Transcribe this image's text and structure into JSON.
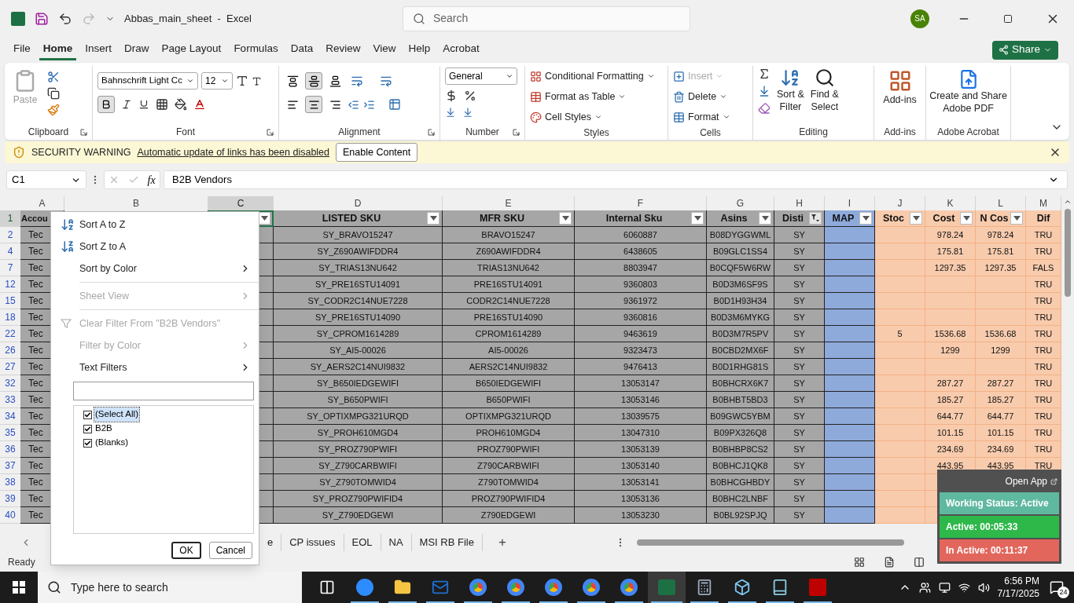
{
  "title_bar": {
    "title": "Abbas_main_sheet  -  Excel",
    "search_placeholder": "Search",
    "avatar": "SA"
  },
  "menu_tabs": [
    {
      "label": "File",
      "selected": false
    },
    {
      "label": "Home",
      "selected": true
    },
    {
      "label": "Insert",
      "selected": false
    },
    {
      "label": "Draw",
      "selected": false
    },
    {
      "label": "Page Layout",
      "selected": false
    },
    {
      "label": "Formulas",
      "selected": false
    },
    {
      "label": "Data",
      "selected": false
    },
    {
      "label": "Review",
      "selected": false
    },
    {
      "label": "View",
      "selected": false
    },
    {
      "label": "Help",
      "selected": false
    },
    {
      "label": "Acrobat",
      "selected": false
    }
  ],
  "share": "Share",
  "ribbon": {
    "clipboard": {
      "paste": "Paste",
      "label": "Clipboard"
    },
    "font": {
      "name": "Bahnschrift Light Cc",
      "size": "12",
      "bold": true,
      "label": "Font"
    },
    "alignment": {
      "vertical": [
        {
          "kind": "top",
          "selected": false
        },
        {
          "kind": "middle",
          "selected": true
        },
        {
          "kind": "bottom",
          "selected": false
        }
      ],
      "horizontal": [
        {
          "kind": "left",
          "selected": false
        },
        {
          "kind": "center",
          "selected": true
        },
        {
          "kind": "right",
          "selected": false
        }
      ],
      "label": "Alignment"
    },
    "number": {
      "format": "General",
      "label": "Number"
    },
    "styles": {
      "items": [
        "Conditional Formatting",
        "Format as Table",
        "Cell Styles"
      ],
      "label": "Styles"
    },
    "cells": {
      "items": [
        {
          "label": "Insert",
          "disabled": true
        },
        {
          "label": "Delete",
          "disabled": false
        },
        {
          "label": "Format",
          "disabled": false
        }
      ],
      "label": "Cells"
    },
    "editing": {
      "sort": [
        "Sort &",
        "Filter"
      ],
      "find": [
        "Find &",
        "Select"
      ],
      "label": "Editing"
    },
    "addins": {
      "button": "Add-ins",
      "label": "Add-ins"
    },
    "acrobat": {
      "button": [
        "Create and Share",
        "Adobe PDF"
      ],
      "label": "Adobe Acrobat"
    }
  },
  "security_warning": {
    "title": "SECURITY WARNING",
    "message": "Automatic update of links has been disabled",
    "button": "Enable Content"
  },
  "formula_bar": {
    "name_box": "C1",
    "fx": "fx",
    "value": "B2B Vendors"
  },
  "sheet": {
    "columns": [
      {
        "letter": "A",
        "header": "Accou",
        "color": "#a6a6a6",
        "selected": false
      },
      {
        "letter": "B",
        "selected": false
      },
      {
        "letter": "C",
        "color": "#a6a6a6",
        "filter_button": true,
        "filtered": false,
        "selected": true
      },
      {
        "letter": "D",
        "header": "LISTED SKU",
        "color": "#a6a6a6",
        "filter_button": true,
        "filtered": false,
        "selected": false
      },
      {
        "letter": "E",
        "header": "MFR SKU",
        "color": "#a6a6a6",
        "filter_button": true,
        "filtered": false,
        "selected": false
      },
      {
        "letter": "F",
        "header": "Internal Sku",
        "color": "#a6a6a6",
        "filter_button": true,
        "filtered": false,
        "selected": false
      },
      {
        "letter": "G",
        "header": "Asins",
        "color": "#a6a6a6",
        "filter_button": true,
        "filtered": false,
        "selected": false
      },
      {
        "letter": "H",
        "header": "Disti",
        "color": "#a6a6a6",
        "filter_button": true,
        "filtered": true,
        "selected": false
      },
      {
        "letter": "I",
        "header": "MAP",
        "color": "#8eaadb",
        "filter_button": true,
        "filtered": false,
        "selected": false
      },
      {
        "letter": "J",
        "header": "Stoc",
        "color": "#f8cbad",
        "filter_button": true,
        "filtered": false,
        "selected": false
      },
      {
        "letter": "K",
        "header": "Cost",
        "color": "#f8cbad",
        "filter_button": true,
        "filtered": false,
        "selected": false
      },
      {
        "letter": "L",
        "header": "N Cos",
        "color": "#f8cbad",
        "filter_button": true,
        "filtered": false,
        "selected": false
      },
      {
        "letter": "M",
        "header": "Dif",
        "color": "#f8cbad",
        "selected": false
      }
    ],
    "rows": [
      {
        "row": "1",
        "selected": true,
        "cells": null
      },
      {
        "row": "2",
        "selected": false,
        "cells": [
          "Tec",
          null,
          null,
          "SY_BRAVO15247",
          "BRAVO15247",
          "6060887",
          "B08DYGGWML",
          "SY",
          null,
          null,
          "978.24",
          "978.24",
          "TRU"
        ]
      },
      {
        "row": "4",
        "selected": false,
        "cells": [
          "Tec",
          null,
          null,
          "SY_Z690AWIFDDR4",
          "Z690AWIFDDR4",
          "6438605",
          "B09GLC1SS4",
          "SY",
          null,
          null,
          "175.81",
          "175.81",
          "TRU"
        ]
      },
      {
        "row": "7",
        "selected": false,
        "cells": [
          "Tec",
          null,
          null,
          "SY_TRIAS13NU642",
          "TRIAS13NU642",
          "8803947",
          "B0CQF5W6RW",
          "SY",
          null,
          null,
          "1297.35",
          "1297.35",
          "FALS"
        ]
      },
      {
        "row": "12",
        "selected": false,
        "cells": [
          "Tec",
          null,
          null,
          "SY_PRE16STU14091",
          "PRE16STU14091",
          "9360803",
          "B0D3M6SF9S",
          "SY",
          null,
          null,
          null,
          null,
          "TRU"
        ]
      },
      {
        "row": "15",
        "selected": false,
        "cells": [
          "Tec",
          null,
          null,
          "SY_CODR2C14NUE7228",
          "CODR2C14NUE7228",
          "9361972",
          "B0D1H93H34",
          "SY",
          null,
          null,
          null,
          null,
          "TRU"
        ]
      },
      {
        "row": "18",
        "selected": false,
        "cells": [
          "Tec",
          null,
          null,
          "SY_PRE16STU14090",
          "PRE16STU14090",
          "9360816",
          "B0D3M6MYKG",
          "SY",
          null,
          null,
          null,
          null,
          "TRU"
        ]
      },
      {
        "row": "22",
        "selected": false,
        "cells": [
          "Tec",
          null,
          null,
          "SY_CPROM1614289",
          "CPROM1614289",
          "9463619",
          "B0D3M7R5PV",
          "SY",
          null,
          "5",
          "1536.68",
          "1536.68",
          "TRU"
        ]
      },
      {
        "row": "26",
        "selected": false,
        "cells": [
          "Tec",
          null,
          null,
          "SY_AI5-00026",
          "AI5-00026",
          "9323473",
          "B0CBD2MX6F",
          "SY",
          null,
          null,
          "1299",
          "1299",
          "TRU"
        ]
      },
      {
        "row": "27",
        "selected": false,
        "cells": [
          "Tec",
          null,
          null,
          "SY_AERS2C14NUI9832",
          "AERS2C14NUI9832",
          "9476413",
          "B0D1RHG81S",
          "SY",
          null,
          null,
          null,
          null,
          "TRU"
        ]
      },
      {
        "row": "32",
        "selected": false,
        "cells": [
          "Tec",
          null,
          null,
          "SY_B650IEDGEWIFI",
          "B650IEDGEWIFI",
          "13053147",
          "B0BHCRX6K7",
          "SY",
          null,
          null,
          "287.27",
          "287.27",
          "TRU"
        ]
      },
      {
        "row": "33",
        "selected": false,
        "cells": [
          "Tec",
          null,
          null,
          "SY_B650PWIFI",
          "B650PWIFI",
          "13053146",
          "B0BHBT5BD3",
          "SY",
          null,
          null,
          "185.27",
          "185.27",
          "TRU"
        ]
      },
      {
        "row": "34",
        "selected": false,
        "cells": [
          "Tec",
          null,
          null,
          "SY_OPTIXMPG321URQD",
          "OPTIXMPG321URQD",
          "13039575",
          "B09GWC5YBM",
          "SY",
          null,
          null,
          "644.77",
          "644.77",
          "TRU"
        ]
      },
      {
        "row": "35",
        "selected": false,
        "cells": [
          "Tec",
          null,
          null,
          "SY_PROH610MGD4",
          "PROH610MGD4",
          "13047310",
          "B09PX326Q8",
          "SY",
          null,
          null,
          "101.15",
          "101.15",
          "TRU"
        ]
      },
      {
        "row": "36",
        "selected": false,
        "cells": [
          "Tec",
          null,
          null,
          "SY_PROZ790PWIFI",
          "PROZ790PWIFI",
          "13053139",
          "B0BHBP8CS2",
          "SY",
          null,
          null,
          "234.69",
          "234.69",
          "TRU"
        ]
      },
      {
        "row": "37",
        "selected": false,
        "cells": [
          "Tec",
          null,
          null,
          "SY_Z790CARBWIFI",
          "Z790CARBWIFI",
          "13053140",
          "B0BHCJ1QK8",
          "SY",
          null,
          null,
          "443.95",
          "443.95",
          "TRU"
        ]
      },
      {
        "row": "38",
        "selected": false,
        "cells": [
          "Tec",
          null,
          null,
          "SY_Z790TOMWID4",
          "Z790TOMWID4",
          "13053141",
          "B0BHCGHBDY",
          "SY",
          null,
          null,
          null,
          null,
          null
        ]
      },
      {
        "row": "39",
        "selected": false,
        "cells": [
          "Tec",
          null,
          null,
          "SY_PROZ790PWIFID4",
          "PROZ790PWIFID4",
          "13053136",
          "B0BHC2LNBF",
          "SY",
          null,
          null,
          null,
          null,
          null
        ]
      },
      {
        "row": "40",
        "selected": false,
        "cells": [
          "Tec",
          null,
          null,
          "SY_Z790EDGEWI",
          "Z790EDGEWI",
          "13053230",
          "B0BL92SPJQ",
          "SY",
          null,
          null,
          null,
          null,
          null
        ]
      }
    ]
  },
  "filter_menu": {
    "items": [
      {
        "kind": "sort_asc",
        "label": "Sort A to Z",
        "disabled": false,
        "submenu": false
      },
      {
        "kind": "sort_desc",
        "label": "Sort Z to A",
        "disabled": false,
        "submenu": false
      },
      {
        "kind": "plain",
        "label": "Sort by Color",
        "disabled": false,
        "submenu": true
      },
      {
        "kind": "separator"
      },
      {
        "kind": "plain",
        "label": "Sheet View",
        "disabled": true,
        "submenu": true
      },
      {
        "kind": "separator"
      },
      {
        "kind": "clear",
        "label": "Clear Filter From \"B2B Vendors\"",
        "disabled": true,
        "submenu": false
      },
      {
        "kind": "plain",
        "label": "Filter by Color",
        "disabled": true,
        "submenu": true
      },
      {
        "kind": "plain",
        "label": "Text Filters",
        "disabled": false,
        "submenu": true
      }
    ],
    "values": [
      {
        "label": "(Select All)",
        "checked": true,
        "selected": true
      },
      {
        "label": "B2B",
        "checked": true,
        "selected": false
      },
      {
        "label": "(Blanks)",
        "checked": true,
        "selected": false
      }
    ],
    "buttons": [
      {
        "label": "OK",
        "focused": true
      },
      {
        "label": "Cancel",
        "focused": false
      }
    ]
  },
  "sheet_tabs": {
    "tabs": [
      {
        "label": "e",
        "selected": false
      },
      {
        "label": "CP issues",
        "selected": false
      },
      {
        "label": "EOL",
        "selected": false
      },
      {
        "label": "NA",
        "selected": false
      },
      {
        "label": "MSI RB File",
        "selected": false
      }
    ],
    "add": "+"
  },
  "status_bar": {
    "mode": "Ready"
  },
  "timer_widget": {
    "open_app": "Open App",
    "status": "Working Status: Active",
    "active": "Active: 00:05:33",
    "inactive": "In Active: 00:11:37"
  },
  "taskbar": {
    "search_placeholder": "Type here to search",
    "apps": [
      {
        "kind": "taskview",
        "running": false,
        "selected": false
      },
      {
        "kind": "zoom",
        "running": true,
        "selected": false
      },
      {
        "kind": "folder",
        "running": true,
        "selected": false
      },
      {
        "kind": "mail",
        "running": true,
        "selected": false
      },
      {
        "kind": "browser",
        "running": true,
        "selected": false
      },
      {
        "kind": "browser",
        "running": true,
        "selected": false
      },
      {
        "kind": "browser",
        "running": true,
        "selected": false
      },
      {
        "kind": "browser",
        "running": true,
        "selected": false
      },
      {
        "kind": "browser",
        "running": true,
        "selected": false
      },
      {
        "kind": "excel",
        "running": true,
        "selected": true
      },
      {
        "kind": "calculator",
        "running": true,
        "selected": false
      },
      {
        "kind": "cube",
        "running": true,
        "selected": false
      },
      {
        "kind": "book",
        "running": true,
        "selected": false
      },
      {
        "kind": "ftp",
        "running": true,
        "selected": false
      }
    ],
    "time": "6:56 PM",
    "date": "7/17/2025",
    "notifications": "24"
  }
}
